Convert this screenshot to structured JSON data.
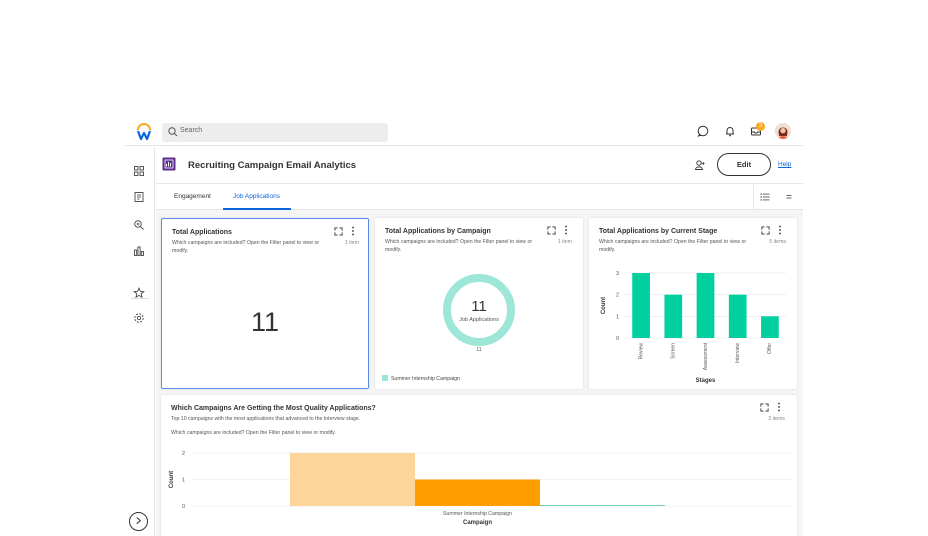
{
  "topbar": {
    "search_placeholder": "Search",
    "notification_badge": "3"
  },
  "header": {
    "title": "Recruiting Campaign Email Analytics",
    "edit_label": "Edit",
    "help_label": "Help"
  },
  "tabs": [
    {
      "label": "Engagement",
      "active": false
    },
    {
      "label": "Job Applications",
      "active": true
    }
  ],
  "cards": {
    "total_applications": {
      "title": "Total Applications",
      "desc": "Which campaigns are included? Open the Filter panel to view or modify.",
      "count": "1 item",
      "value": "11"
    },
    "by_campaign": {
      "title": "Total Applications by Campaign",
      "desc": "Which campaigns are included? Open the Filter panel to view or modify.",
      "count": "1 item",
      "center_value": "11",
      "center_label": "Job Applications",
      "slice_label": "11",
      "legend": "Summer Internship Campaign"
    },
    "by_stage": {
      "title": "Total Applications by Current Stage",
      "desc": "Which campaigns are included? Open the Filter panel to view or modify.",
      "count": "5 items"
    },
    "quality": {
      "title": "Which Campaigns Are Getting the Most Quality Applications?",
      "subtitle": "Top 10 campaigns with the most applications that advanced to the Interview stage.",
      "desc": "Which campaigns are included? Open the Filter panel to view or modify.",
      "count": "3 items"
    }
  },
  "chart_data": [
    {
      "type": "pie",
      "categories": [
        "Summer Internship Campaign"
      ],
      "values": [
        11
      ],
      "center_text": "11 Job Applications",
      "colors": [
        "#9ee6d8"
      ]
    },
    {
      "type": "bar",
      "categories": [
        "Review",
        "Screen",
        "Assessment",
        "Interview",
        "Offer"
      ],
      "values": [
        3,
        2,
        3,
        2,
        1
      ],
      "xlabel": "Stages",
      "ylabel": "Count",
      "ylim": [
        0,
        3
      ],
      "yticks": [
        "0",
        "1",
        "2",
        "3"
      ],
      "color": "#00d0a0"
    },
    {
      "type": "bar",
      "categories": [
        "Summer Internship Campaign"
      ],
      "series": [
        {
          "values": [
            2
          ],
          "color": "#fdd59a"
        },
        {
          "values": [
            1
          ],
          "color": "#ff9e00"
        },
        {
          "values": [
            0
          ],
          "color": "#4cc7a8"
        }
      ],
      "xlabel": "Campaign",
      "ylabel": "Count",
      "ylim": [
        0,
        2
      ],
      "yticks": [
        "0",
        "1",
        "2"
      ]
    }
  ],
  "colors": {
    "accent": "#0b66d8",
    "teal": "#00d0a0",
    "orange": "#ff9e00",
    "light_orange": "#fdd59a",
    "badge": "#f7a823"
  }
}
